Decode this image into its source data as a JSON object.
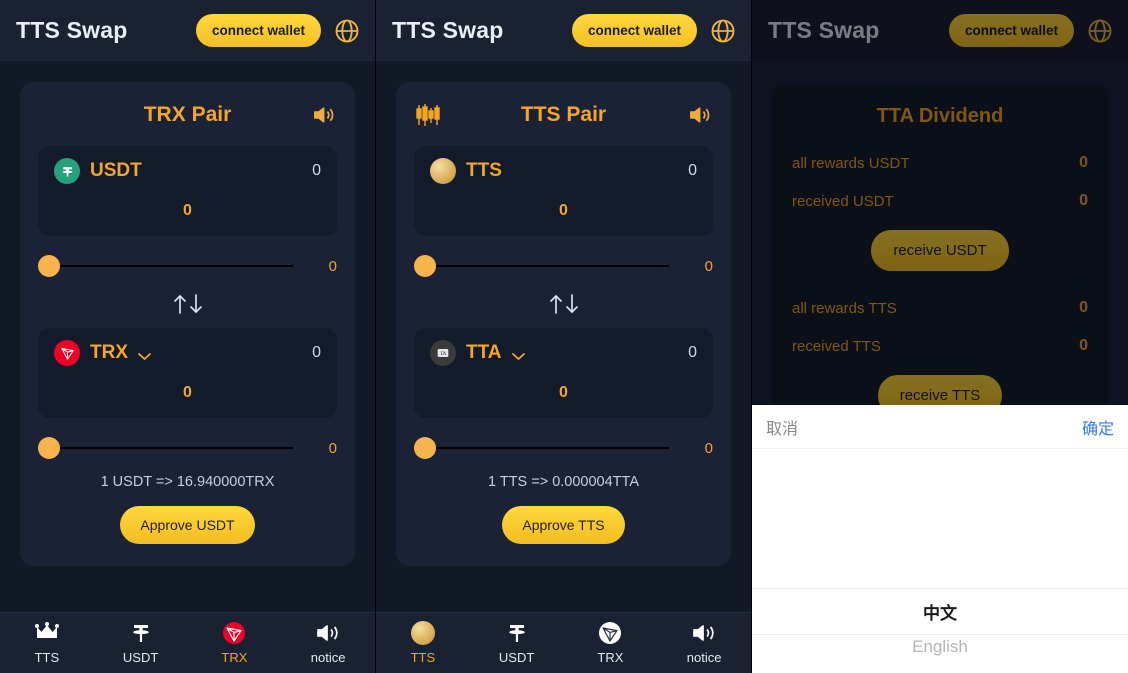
{
  "header": {
    "title": "TTS Swap",
    "connect_label": "connect wallet",
    "globe_icon": "globe-icon"
  },
  "panel1": {
    "card_title": "TRX Pair",
    "speaker_icon": "speaker-icon",
    "from": {
      "icon": "usdt-icon",
      "symbol": "USDT",
      "balance": "0",
      "amount": "0",
      "slider_value": "0"
    },
    "swap_icon": "swap-arrows-icon",
    "to": {
      "icon": "trx-icon",
      "symbol": "TRX",
      "chevron_icon": "chevron-down-icon",
      "balance": "0",
      "amount": "0",
      "slider_value": "0"
    },
    "rate": "1 USDT => 16.940000TRX",
    "approve_label": "Approve USDT",
    "nav": [
      {
        "icon": "crown-icon",
        "label": "TTS",
        "active": false
      },
      {
        "icon": "tether-icon",
        "label": "USDT",
        "active": false
      },
      {
        "icon": "tron-icon",
        "label": "TRX",
        "active": true
      },
      {
        "icon": "speaker-icon",
        "label": "notice",
        "active": false
      }
    ]
  },
  "panel2": {
    "card_title": "TTS Pair",
    "kline_icon": "candlestick-chart-icon",
    "speaker_icon": "speaker-icon",
    "from": {
      "icon": "tts-coin-icon",
      "symbol": "TTS",
      "balance": "0",
      "amount": "0",
      "slider_value": "0"
    },
    "swap_icon": "swap-arrows-icon",
    "to": {
      "icon": "tta-icon",
      "symbol": "TTA",
      "chevron_icon": "chevron-down-icon",
      "balance": "0",
      "amount": "0",
      "slider_value": "0"
    },
    "rate": "1 TTS => 0.000004TTA",
    "approve_label": "Approve TTS",
    "nav": [
      {
        "icon": "tts-coin-icon",
        "label": "TTS",
        "active": true
      },
      {
        "icon": "tether-icon",
        "label": "USDT",
        "active": false
      },
      {
        "icon": "tron-white-icon",
        "label": "TRX",
        "active": false
      },
      {
        "icon": "speaker-icon",
        "label": "notice",
        "active": false
      }
    ]
  },
  "panel3": {
    "card_title": "TTA Dividend",
    "rows": [
      {
        "label": "all rewards USDT",
        "value": "0"
      },
      {
        "label": "received USDT",
        "value": "0"
      }
    ],
    "usdt_button": "receive USDT",
    "rows2": [
      {
        "label": "all rewards TTS",
        "value": "0"
      },
      {
        "label": "received TTS",
        "value": "0"
      }
    ],
    "tts_button": "receive TTS",
    "language_modal": {
      "cancel": "取消",
      "confirm": "确定",
      "selected": "中文",
      "other": "English"
    }
  },
  "colors": {
    "accent": "#f5a623",
    "button": "#ffd83d",
    "usdt_green": "#26a17b",
    "trx_red": "#ef0027",
    "modal_confirm": "#3478f6"
  }
}
